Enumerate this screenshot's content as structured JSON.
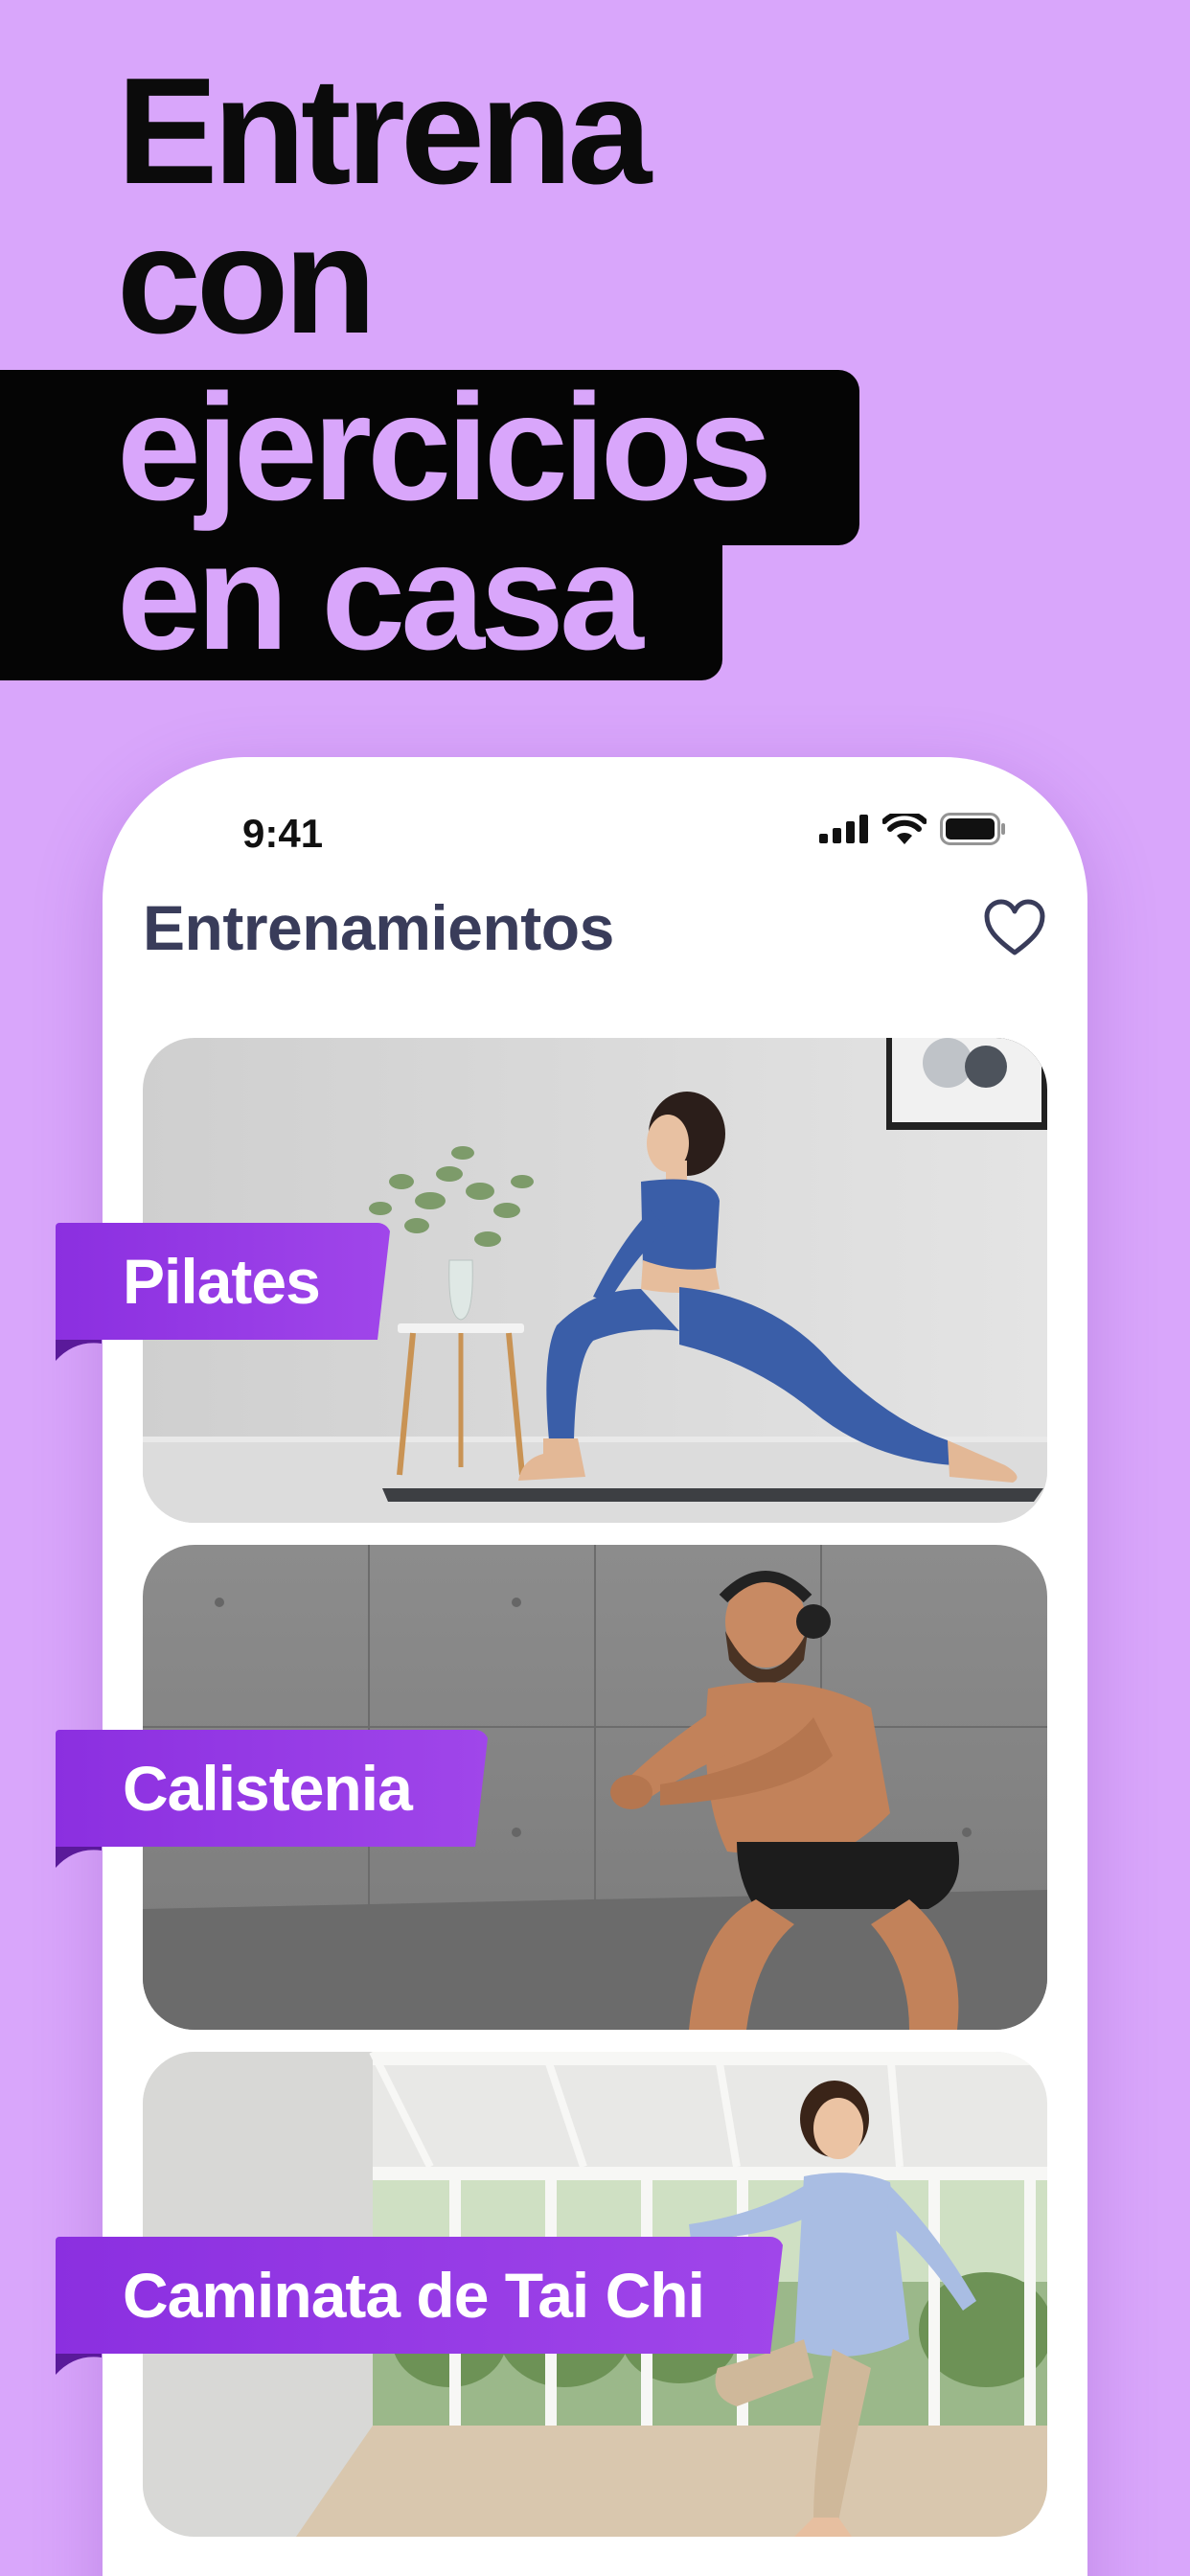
{
  "headline": {
    "line1": "Entrena",
    "line2": "con",
    "line3": "ejercicios",
    "line4": "en casa"
  },
  "status_bar": {
    "time": "9:41",
    "icons": [
      "cellular-signal-icon",
      "wifi-icon",
      "battery-icon"
    ]
  },
  "header": {
    "title": "Entrenamientos",
    "favorite_icon": "heart-icon"
  },
  "workouts": [
    {
      "label": "Pilates"
    },
    {
      "label": "Calistenia"
    },
    {
      "label": "Caminata de Tai Chi"
    }
  ],
  "colors": {
    "background": "#d9a6fb",
    "accent_purple": "#9a3fe8",
    "title_text": "#393c5a",
    "black": "#050505"
  }
}
